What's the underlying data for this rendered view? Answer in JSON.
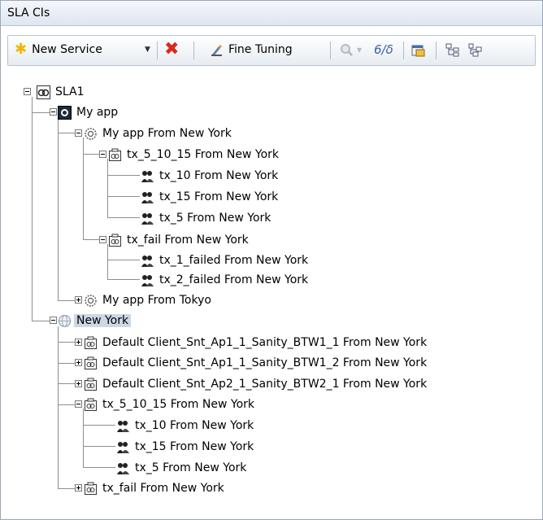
{
  "panel": {
    "title": "SLA CIs"
  },
  "toolbar": {
    "new_service_label": "New Service",
    "fine_tuning_label": "Fine Tuning"
  },
  "tree": {
    "sla1": "SLA1",
    "my_app": "My app",
    "my_app_ny": "My app From New York",
    "tx_5_10_15_ny_a": "tx_5_10_15 From New York",
    "tx_10_ny_a": "tx_10 From New York",
    "tx_15_ny_a": "tx_15 From New York",
    "tx_5_ny_a": "tx_5 From New York",
    "tx_fail_ny_a": "tx_fail From New York",
    "tx_1_failed_ny": "tx_1_failed From New York",
    "tx_2_failed_ny": "tx_2_failed From New York",
    "my_app_tokyo": "My app From Tokyo",
    "new_york": "New York",
    "default_1": "Default Client_Snt_Ap1_1_Sanity_BTW1_1 From New York",
    "default_2": "Default Client_Snt_Ap1_1_Sanity_BTW1_2 From New York",
    "default_3": "Default Client_Snt_Ap2_1_Sanity_BTW2_1 From New York",
    "tx_5_10_15_ny_b": "tx_5_10_15 From New York",
    "tx_10_ny_b": "tx_10 From New York",
    "tx_15_ny_b": "tx_15 From New York",
    "tx_5_ny_b": "tx_5 From New York",
    "tx_fail_ny_b": "tx_fail From New York"
  },
  "icons": {
    "sla": "sla-icon",
    "application": "application-icon",
    "group": "gear-group-icon",
    "transaction_group": "transaction-group-icon",
    "transaction": "transaction-icon",
    "location": "location-globe-icon"
  },
  "colors": {
    "selection": "#cdd8e6",
    "delete_red": "#d62b1f",
    "new_star": "#f2b705"
  }
}
